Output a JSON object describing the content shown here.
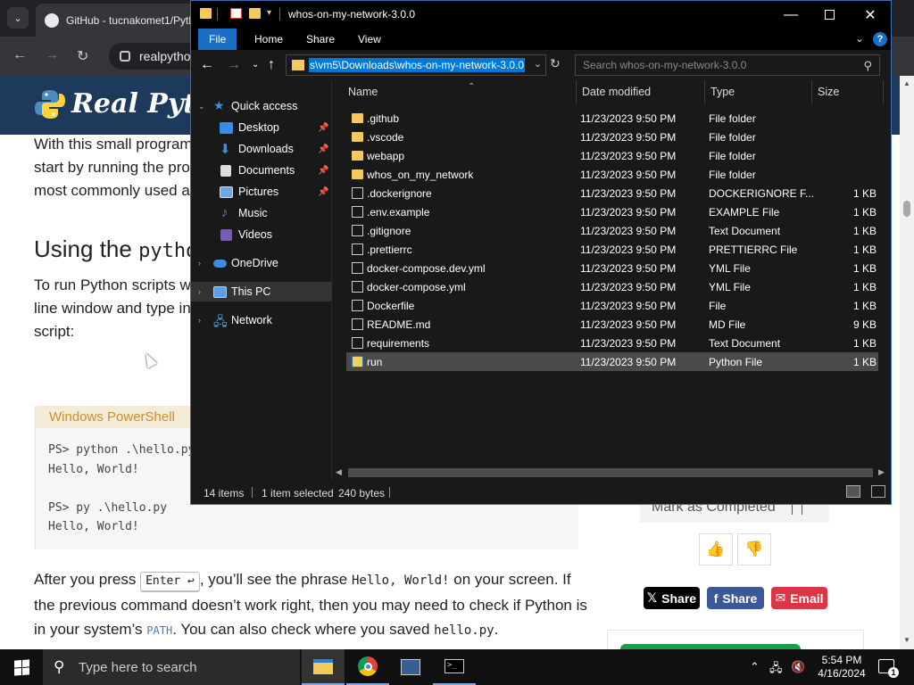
{
  "browser": {
    "tab_title": "GitHub - tucnakomet1/Pytl",
    "address": "realpytho",
    "page": {
      "logo_text": "Real Python",
      "para1_lines": [
        "With this small program",
        "start by running the pro",
        "most commonly used a"
      ],
      "heading_prefix": "Using the ",
      "heading_code": "pytho",
      "para2_lines": [
        "To run Python scripts w",
        "line window and type in",
        "script:"
      ],
      "code_title": "Windows PowerShell",
      "code_lines": "PS> python .\\hello.py\nHello, World!\n\nPS> py .\\hello.py\nHello, World!",
      "after": {
        "t1": "After you press ",
        "key": "Enter ↩",
        "t2": ", you’ll see the phrase ",
        "c1": "Hello, World!",
        "t3": " on your screen. If the previous command doesn’t work right, then you may need to check if Python is in your system’s ",
        "c2": "PATH",
        "t4": ". You can also check where you saved ",
        "c3": "hello.py",
        "t5": "."
      },
      "mark_completed": "Mark as Completed",
      "share_x": "Share",
      "share_fb": "Share",
      "share_email": "Email"
    }
  },
  "explorer": {
    "title": "whos-on-my-network-3.0.0",
    "ribbon_tabs": [
      "File",
      "Home",
      "Share",
      "View"
    ],
    "address": "s\\vm5\\Downloads\\whos-on-my-network-3.0.0",
    "search_placeholder": "Search whos-on-my-network-3.0.0",
    "nav": {
      "quick_access": "Quick access",
      "desktop": "Desktop",
      "downloads": "Downloads",
      "documents": "Documents",
      "pictures": "Pictures",
      "music": "Music",
      "videos": "Videos",
      "onedrive": "OneDrive",
      "this_pc": "This PC",
      "network": "Network"
    },
    "columns": {
      "name": "Name",
      "date": "Date modified",
      "type": "Type",
      "size": "Size"
    },
    "files": [
      {
        "name": ".github",
        "date": "11/23/2023 9:50 PM",
        "type": "File folder",
        "size": "",
        "icon": "folder"
      },
      {
        "name": ".vscode",
        "date": "11/23/2023 9:50 PM",
        "type": "File folder",
        "size": "",
        "icon": "folder"
      },
      {
        "name": "webapp",
        "date": "11/23/2023 9:50 PM",
        "type": "File folder",
        "size": "",
        "icon": "folder"
      },
      {
        "name": "whos_on_my_network",
        "date": "11/23/2023 9:50 PM",
        "type": "File folder",
        "size": "",
        "icon": "folder"
      },
      {
        "name": ".dockerignore",
        "date": "11/23/2023 9:50 PM",
        "type": "DOCKERIGNORE F...",
        "size": "1 KB",
        "icon": "doc"
      },
      {
        "name": ".env.example",
        "date": "11/23/2023 9:50 PM",
        "type": "EXAMPLE File",
        "size": "1 KB",
        "icon": "doc"
      },
      {
        "name": ".gitignore",
        "date": "11/23/2023 9:50 PM",
        "type": "Text Document",
        "size": "1 KB",
        "icon": "doc"
      },
      {
        "name": ".prettierrc",
        "date": "11/23/2023 9:50 PM",
        "type": "PRETTIERRC File",
        "size": "1 KB",
        "icon": "doc"
      },
      {
        "name": "docker-compose.dev.yml",
        "date": "11/23/2023 9:50 PM",
        "type": "YML File",
        "size": "1 KB",
        "icon": "doc"
      },
      {
        "name": "docker-compose.yml",
        "date": "11/23/2023 9:50 PM",
        "type": "YML File",
        "size": "1 KB",
        "icon": "doc"
      },
      {
        "name": "Dockerfile",
        "date": "11/23/2023 9:50 PM",
        "type": "File",
        "size": "1 KB",
        "icon": "doc"
      },
      {
        "name": "README.md",
        "date": "11/23/2023 9:50 PM",
        "type": "MD File",
        "size": "9 KB",
        "icon": "doc"
      },
      {
        "name": "requirements",
        "date": "11/23/2023 9:50 PM",
        "type": "Text Document",
        "size": "1 KB",
        "icon": "doc"
      },
      {
        "name": "run",
        "date": "11/23/2023 9:50 PM",
        "type": "Python File",
        "size": "1 KB",
        "icon": "python"
      }
    ],
    "selected_file": "run",
    "status": {
      "items": "14 items",
      "selected": "1 item selected",
      "size": "240 bytes"
    }
  },
  "taskbar": {
    "search_placeholder": "Type here to search",
    "time": "5:54 PM",
    "date": "4/16/2024",
    "notification_count": "1"
  },
  "colors": {
    "accent": "#0078d7",
    "folder": "#f4c95d",
    "rp_header": "#1d3a5c",
    "share_x": "#000000",
    "share_fb": "#3b5998",
    "share_email": "#dc3545"
  }
}
